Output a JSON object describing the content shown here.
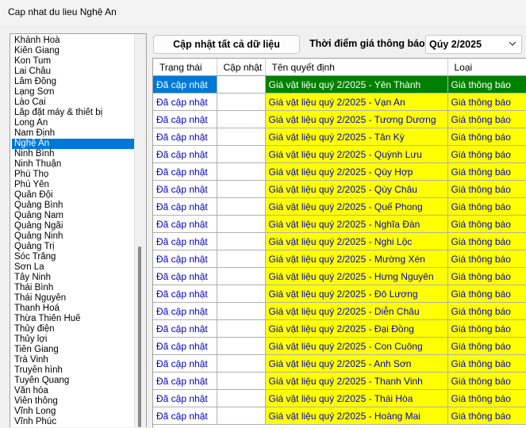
{
  "window": {
    "title": "Cap nhat du lieu Nghệ An"
  },
  "province_list": {
    "items": [
      "Khánh Hoà",
      "Kiên Giang",
      "Kon Tum",
      "Lai Châu",
      "Lâm Đồng",
      "Lạng Sơn",
      "Lào Cai",
      "Lắp đặt máy & thiết bị",
      "Long An",
      "Nam Định",
      "Nghệ An",
      "Ninh Bình",
      "Ninh Thuận",
      "Phú Thọ",
      "Phú Yên",
      "Quân Đội",
      "Quảng Bình",
      "Quảng Nam",
      "Quảng Ngãi",
      "Quảng Ninh",
      "Quảng Trị",
      "Sóc Trăng",
      "Sơn La",
      "Tây Ninh",
      "Thái Bình",
      "Thái Nguyên",
      "Thanh Hoá",
      "Thừa Thiên Huế",
      "Thủy điện",
      "Thủy lợi",
      "Tiền Giang",
      "Trà Vinh",
      "Truyền hình",
      "Tuyên Quang",
      "Văn hóa",
      "Viễn thông",
      "Vĩnh Long",
      "Vĩnh Phúc"
    ],
    "selected": "Nghệ An"
  },
  "toolbar": {
    "update_all_label": "Cập nhật tất cả dữ liệu",
    "period_label": "Thời điểm giá thông báo",
    "period_value": "Qúy 2/2025"
  },
  "grid": {
    "headers": [
      "Trạng thái",
      "Cập nhật",
      "Tên quyết định",
      "Loại"
    ],
    "rows": [
      {
        "status": "Đã cập nhật",
        "update": "",
        "name": "Giá vật liệu quý 2/2025 - Yên Thành",
        "type": "Giá thông báo"
      },
      {
        "status": "Đã cập nhật",
        "update": "",
        "name": "Giá vật liệu quý 2/2025 - Vạn An",
        "type": "Giá thông báo"
      },
      {
        "status": "Đã cập nhật",
        "update": "",
        "name": "Giá vật liệu quý 2/2025 - Tương Dương",
        "type": "Giá thông báo"
      },
      {
        "status": "Đã cập nhật",
        "update": "",
        "name": "Giá vật liệu quý 2/2025 - Tân Kỳ",
        "type": "Giá thông báo"
      },
      {
        "status": "Đã cập nhật",
        "update": "",
        "name": "Giá vật liệu quý 2/2025 - Quỳnh Lưu",
        "type": "Giá thông báo"
      },
      {
        "status": "Đã cập nhật",
        "update": "",
        "name": "Giá vật liệu quý 2/2025 - Qùy Hợp",
        "type": "Giá thông báo"
      },
      {
        "status": "Đã cập nhật",
        "update": "",
        "name": "Giá vật liệu quý 2/2025 - Qùy Châu",
        "type": "Giá thông báo"
      },
      {
        "status": "Đã cập nhật",
        "update": "",
        "name": "Giá vật liệu quý 2/2025 - Quế Phong",
        "type": "Giá thông báo"
      },
      {
        "status": "Đã cập nhật",
        "update": "",
        "name": "Giá vật liệu quý 2/2025 - Nghĩa Đàn",
        "type": "Giá thông báo"
      },
      {
        "status": "Đã cập nhật",
        "update": "",
        "name": "Giá vật liệu quý 2/2025 - Nghi Lộc",
        "type": "Giá thông báo"
      },
      {
        "status": "Đã cập nhật",
        "update": "",
        "name": "Giá vật liệu quý 2/2025 - Mường Xén",
        "type": "Giá thông báo"
      },
      {
        "status": "Đã cập nhật",
        "update": "",
        "name": "Giá vật liệu quý 2/2025 - Hưng Nguyên",
        "type": "Giá thông báo"
      },
      {
        "status": "Đã cập nhật",
        "update": "",
        "name": "Giá vật liệu quý 2/2025 - Đô Lương",
        "type": "Giá thông báo"
      },
      {
        "status": "Đã cập nhật",
        "update": "",
        "name": "Giá vật liệu quý 2/2025 - Diễn Châu",
        "type": "Giá thông báo"
      },
      {
        "status": "Đã cập nhật",
        "update": "",
        "name": "Giá vật liệu quý 2/2025 - Đại Đồng",
        "type": "Giá thông báo"
      },
      {
        "status": "Đã cập nhật",
        "update": "",
        "name": "Giá vật liệu quý 2/2025 - Con Cuông",
        "type": "Giá thông báo"
      },
      {
        "status": "Đã cập nhật",
        "update": "",
        "name": "Giá vật liệu quý 2/2025 - Anh Sơn",
        "type": "Giá thông báo"
      },
      {
        "status": "Đã cập nhật",
        "update": "",
        "name": "Giá vật liệu quý 2/2025 - Thanh Vinh",
        "type": "Giá thông báo"
      },
      {
        "status": "Đã cập nhật",
        "update": "",
        "name": "Giá vật liệu quý 2/2025 - Thái Hòa",
        "type": "Giá thông báo"
      },
      {
        "status": "Đã cập nhật",
        "update": "",
        "name": "Giá vật liệu quý 2/2025 - Hoàng Mai",
        "type": "Giá thông báo"
      }
    ],
    "selected_row": 0
  },
  "colors": {
    "selection_blue": "#0078d7",
    "selected_row_green": "#008000",
    "highlight_yellow": "#ffff00",
    "status_text_blue": "#0000c0"
  }
}
